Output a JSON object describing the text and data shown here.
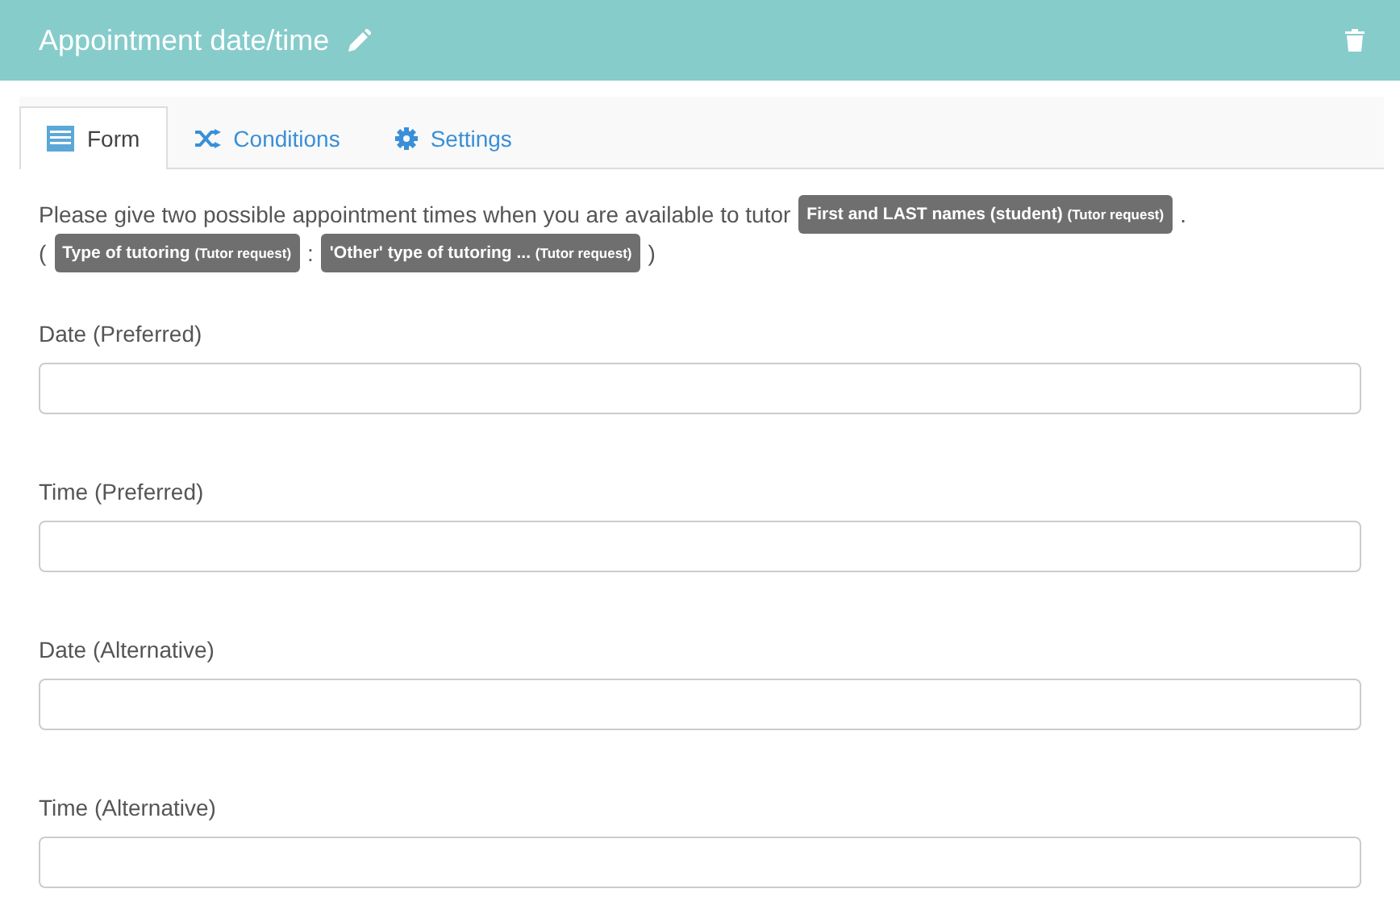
{
  "header": {
    "title": "Appointment date/time"
  },
  "tabs": [
    {
      "label": "Form",
      "kind": "form",
      "selected": true
    },
    {
      "label": "Conditions",
      "kind": "conditions",
      "selected": false
    },
    {
      "label": "Settings",
      "kind": "settings",
      "selected": false
    }
  ],
  "description": [
    [
      {
        "kind": "text",
        "text": "Please give two possible appointment times when you are available to tutor"
      },
      {
        "kind": "tag",
        "text": "First and LAST names (student)",
        "source": "(Tutor request)"
      },
      {
        "kind": "text",
        "text": "."
      }
    ],
    [
      {
        "kind": "text",
        "text": "("
      },
      {
        "kind": "tag",
        "text": "Type of tutoring",
        "source": "(Tutor request)"
      },
      {
        "kind": "text",
        "text": ":"
      },
      {
        "kind": "tag",
        "text": "'Other' type of tutoring ...",
        "source": "(Tutor request)"
      },
      {
        "kind": "text",
        "text": ")"
      }
    ]
  ],
  "fields": [
    {
      "label": "Date (Preferred)"
    },
    {
      "label": "Time (Preferred)"
    },
    {
      "label": "Date (Alternative)"
    },
    {
      "label": "Time (Alternative)"
    }
  ]
}
